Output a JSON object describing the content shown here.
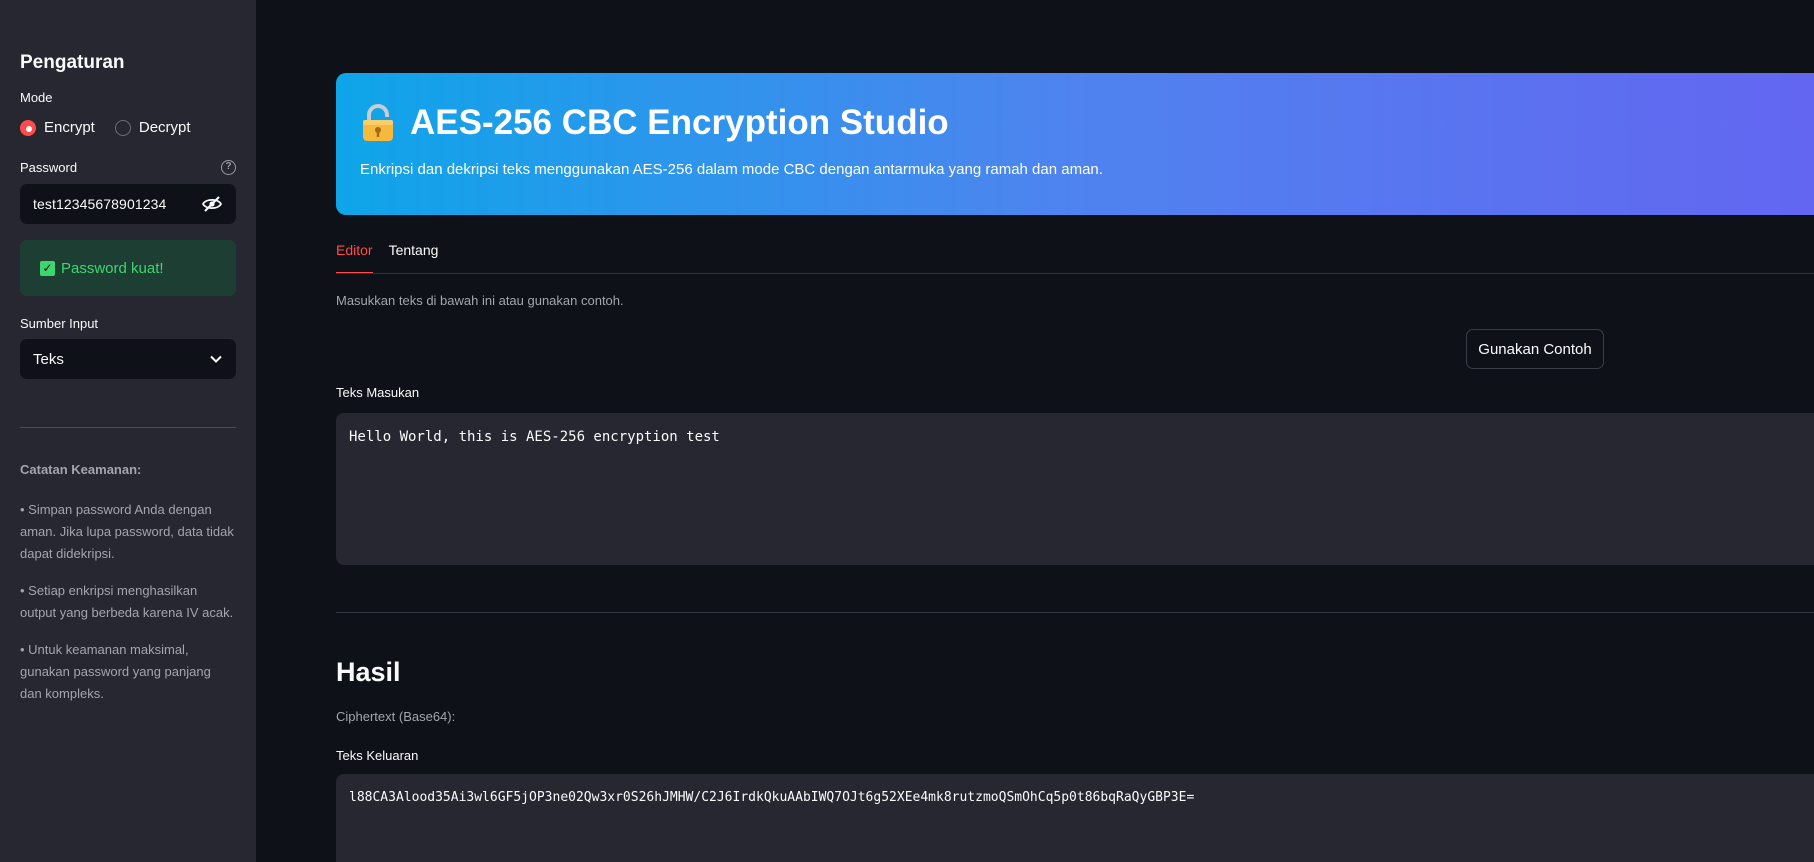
{
  "sidebar": {
    "title": "Pengaturan",
    "mode_label": "Mode",
    "mode_options": [
      "Encrypt",
      "Decrypt"
    ],
    "mode_selected": "Encrypt",
    "password_label": "Password",
    "password_value": "test12345678901234",
    "password_status": "Password kuat!",
    "source_label": "Sumber Input",
    "source_value": "Teks",
    "notes_title": "Catatan Keamanan:",
    "notes": [
      "• Simpan password Anda dengan aman. Jika lupa password, data tidak dapat didekripsi.",
      "• Setiap enkripsi menghasilkan output yang berbeda karena IV acak.",
      "• Untuk keamanan maksimal, gunakan password yang panjang dan kompleks."
    ]
  },
  "banner": {
    "title": "AES-256 CBC Encryption Studio",
    "subtitle": "Enkripsi dan dekripsi teks menggunakan AES-256 dalam mode CBC dengan antarmuka yang ramah dan aman."
  },
  "tabs": [
    {
      "label": "Editor",
      "active": true
    },
    {
      "label": "Tentang",
      "active": false
    }
  ],
  "editor": {
    "hint": "Masukkan teks di bawah ini atau gunakan contoh.",
    "example_button": "Gunakan Contoh",
    "input_label": "Teks Masukan",
    "input_value": "Hello World, this is AES-256 encryption test"
  },
  "result": {
    "title": "Hasil",
    "cipher_label": "Ciphertext (Base64):",
    "output_label": "Teks Keluaran",
    "output_value": "l88CA3Alood35Ai3wl6GF5jOP3ne02Qw3xr0S26hJMHW/C2J6IrdkQkuAAbIWQ7OJt6g52XEe4mk8rutzmoQSmOhCq5p0t86bqRaQyGBP3E="
  },
  "colors": {
    "accent": "#ff4b4b",
    "success": "#3dd56d",
    "banner_start": "#0ea5e9",
    "banner_end": "#6366f1"
  }
}
